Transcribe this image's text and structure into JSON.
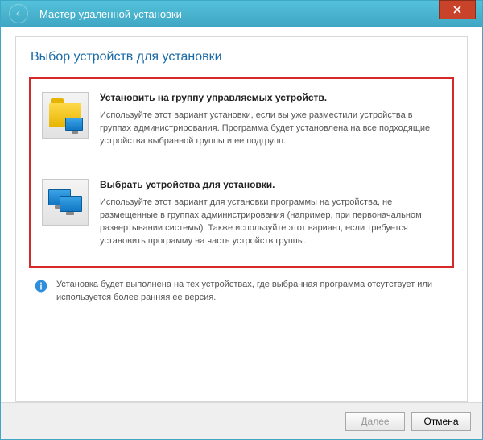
{
  "window": {
    "title": "Мастер удаленной установки"
  },
  "page": {
    "heading": "Выбор устройств для установки"
  },
  "options": [
    {
      "title": "Установить на группу управляемых устройств.",
      "desc": "Используйте этот вариант установки, если вы уже разместили устройства в группах администрирования. Программа будет установлена на все подходящие устройства выбранной группы и ее подгрупп."
    },
    {
      "title": "Выбрать устройства для установки.",
      "desc": "Используйте этот вариант для установки программы на устройства, не размещенные в группах администрирования (например, при первоначальном развертывании системы). Также используйте этот вариант, если требуется установить программу на часть устройств группы."
    }
  ],
  "info": {
    "text": "Установка будет выполнена на тех устройствах, где выбранная программа отсутствует или используется более ранняя ее версия."
  },
  "footer": {
    "next": "Далее",
    "cancel": "Отмена"
  }
}
